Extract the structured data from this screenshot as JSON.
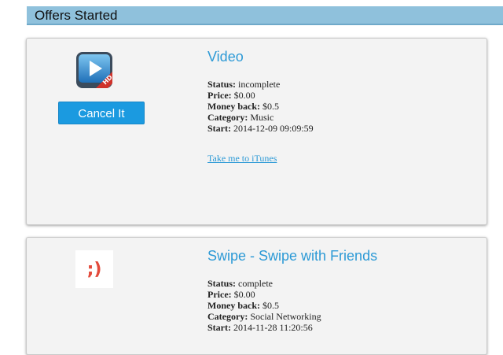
{
  "header": {
    "title": "Offers Started"
  },
  "offers": [
    {
      "title": "Video",
      "icon": "video-hd-app-icon",
      "cancel_label": "Cancel It",
      "status_label": "Status:",
      "status": "incomplete",
      "price_label": "Price:",
      "price": "$0.00",
      "money_back_label": "Money back:",
      "money_back": "$0.5",
      "category_label": "Category:",
      "category": "Music",
      "start_label": "Start:",
      "start": "2014-12-09 09:09:59",
      "link_label": "Take me to iTunes"
    },
    {
      "title": "Swipe - Swipe with Friends",
      "icon": "swipe-app-icon",
      "icon_text": ";)",
      "status_label": "Status:",
      "status": "complete",
      "price_label": "Price:",
      "price": "$0.00",
      "money_back_label": "Money back:",
      "money_back": "$0.5",
      "category_label": "Category:",
      "category": "Social Networking",
      "start_label": "Start:",
      "start": "2014-11-28 11:20:56"
    }
  ],
  "colors": {
    "header_bg": "#8fc1dc",
    "accent": "#2d9ad6",
    "button_bg": "#1b9ae0",
    "card_bg": "#f3f3f3"
  }
}
